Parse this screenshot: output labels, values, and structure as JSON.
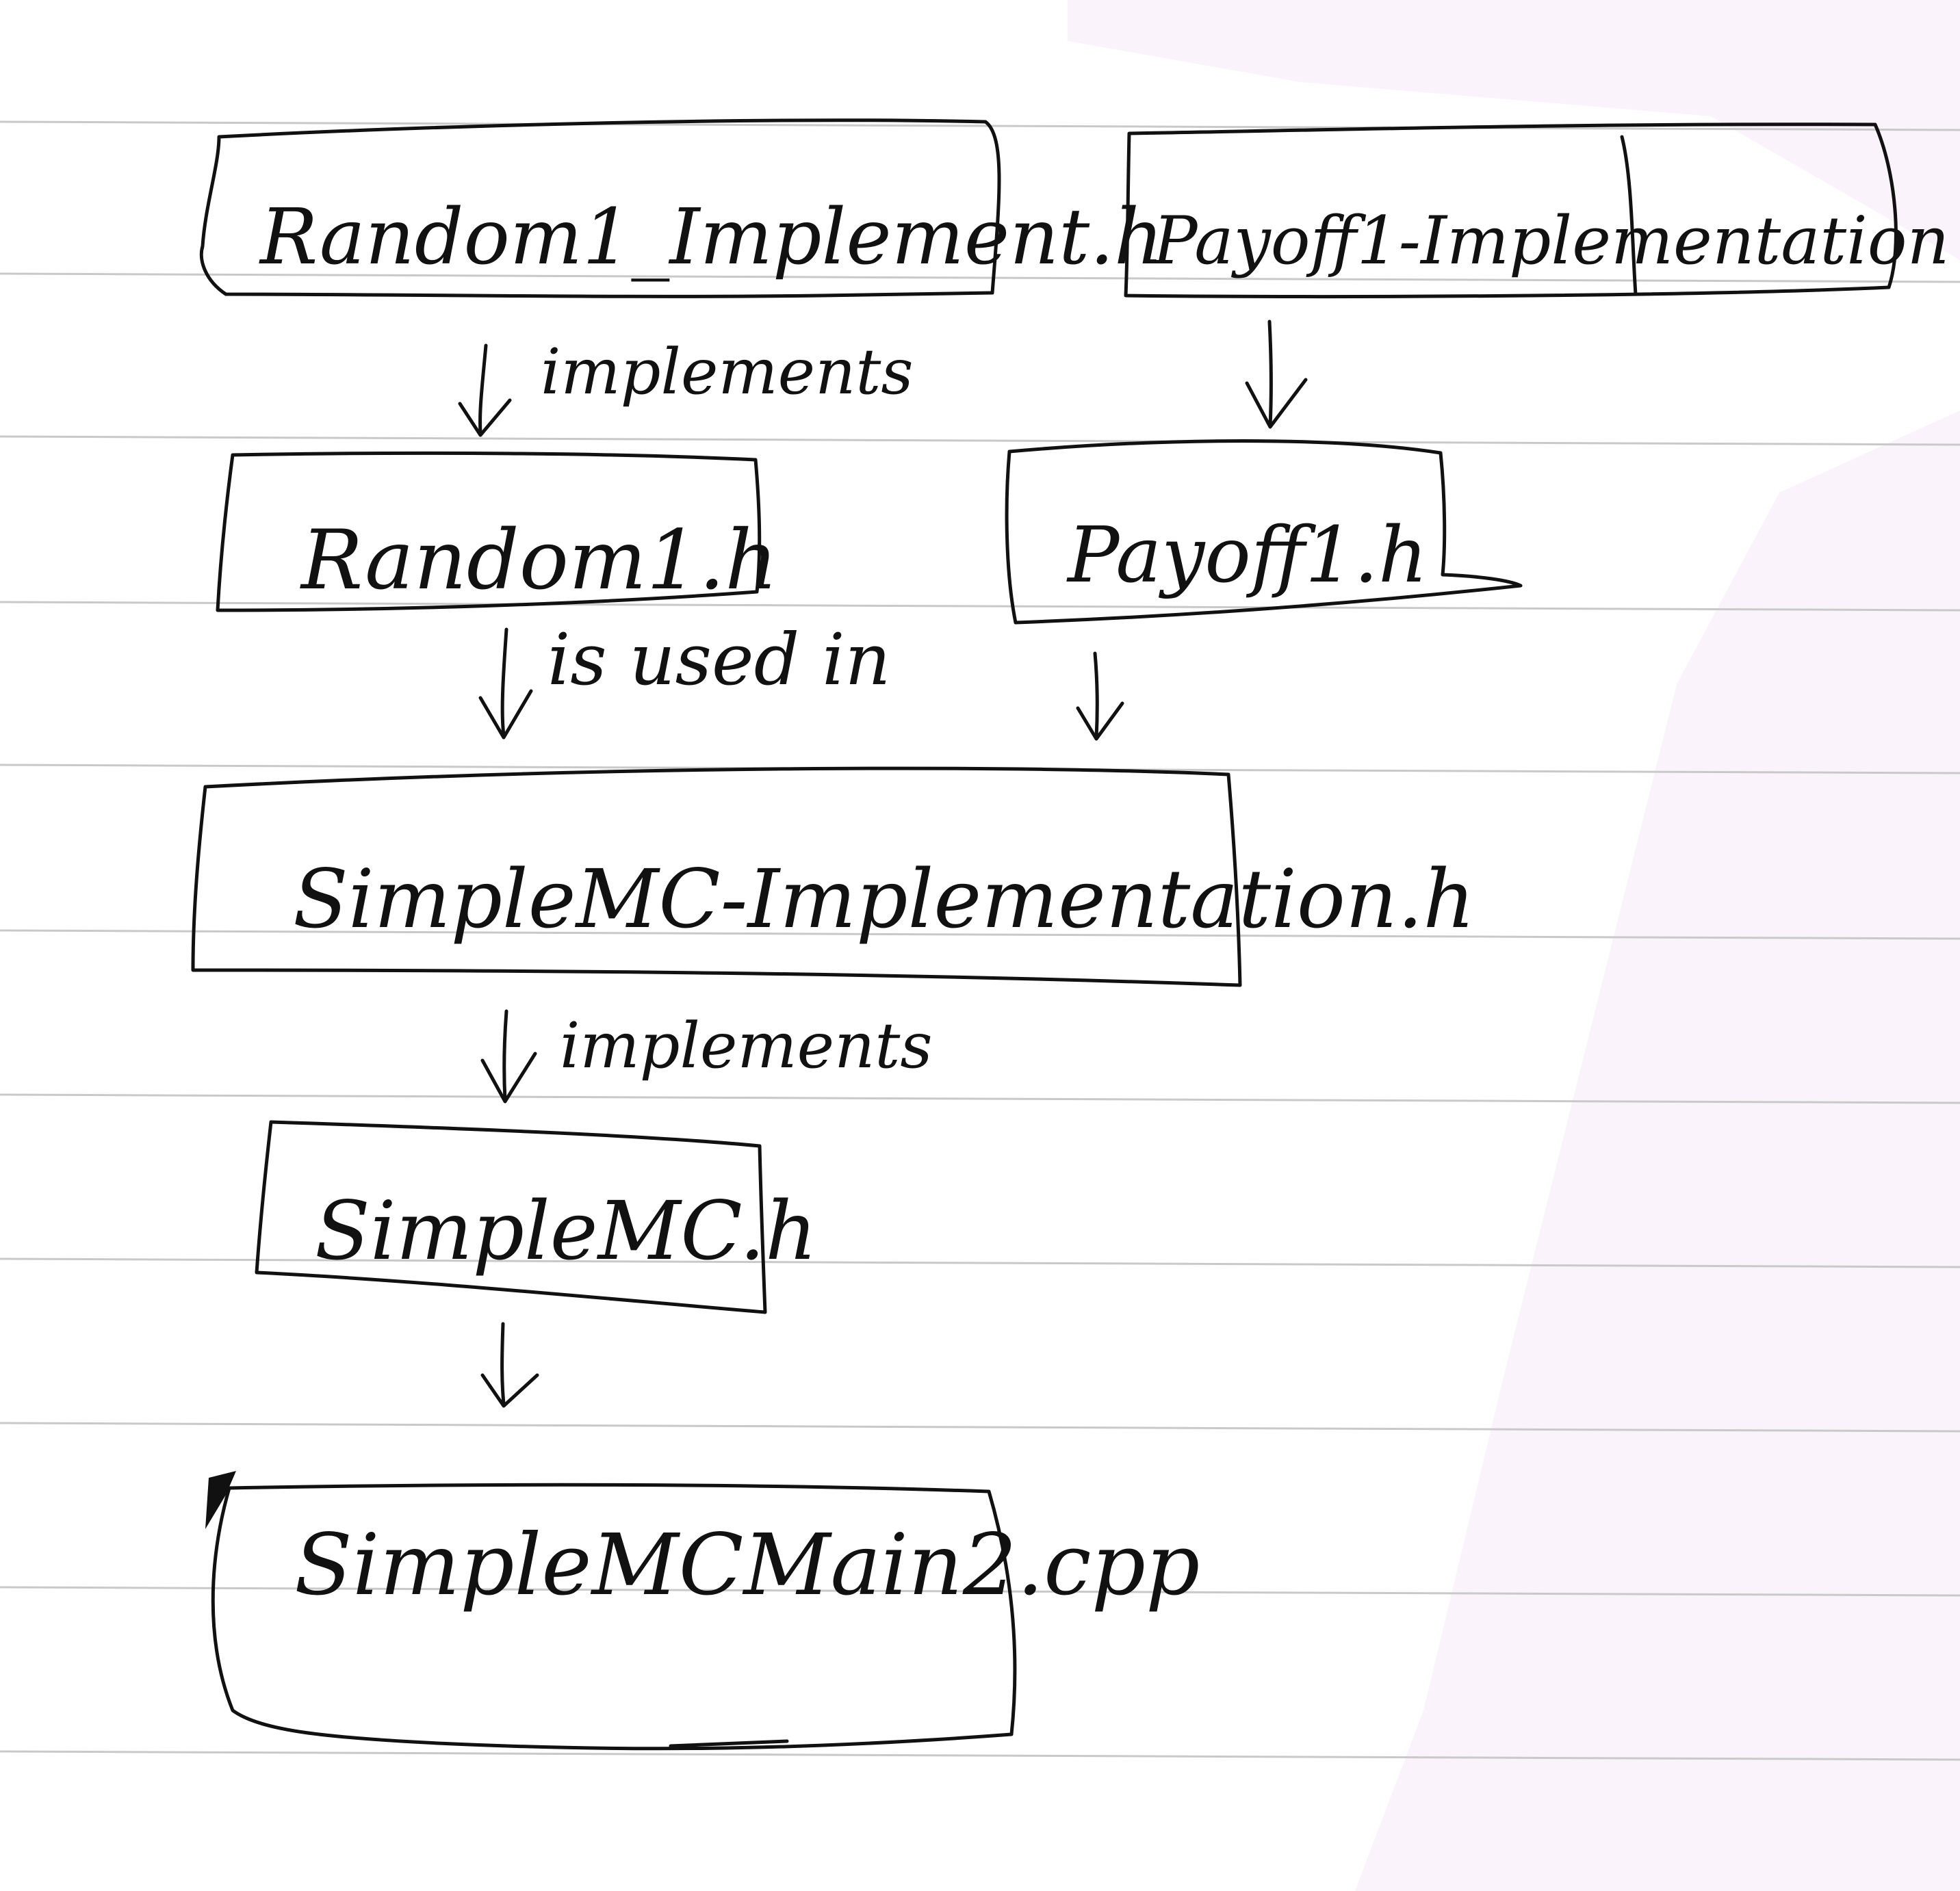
{
  "colors": {
    "ink": "#111111",
    "paper": "#ffffff",
    "rule_line": "#c9c9c9",
    "shadow_tint": "#fbf3fb"
  },
  "nodes": {
    "random_impl": {
      "label": "Random1_Implement.h"
    },
    "payoff_impl": {
      "label": "Payoff1-Implementation"
    },
    "random": {
      "label": "Random1.h"
    },
    "payoff": {
      "label": "Payoff1.h"
    },
    "simplemc_impl": {
      "label": "SimpleMC-Implementation.h"
    },
    "simplemc": {
      "label": "SimpleMC.h"
    },
    "main": {
      "label": "SimpleMCMain2.cpp"
    }
  },
  "edges": {
    "random_impl_to_random": {
      "label": "implements"
    },
    "payoff_impl_to_payoff": {
      "label": ""
    },
    "random_to_simplemc_impl": {
      "label": "is used in"
    },
    "payoff_to_simplemc_impl": {
      "label": ""
    },
    "simplemc_impl_to_simplemc": {
      "label": "implements"
    },
    "simplemc_to_main": {
      "label": ""
    }
  }
}
